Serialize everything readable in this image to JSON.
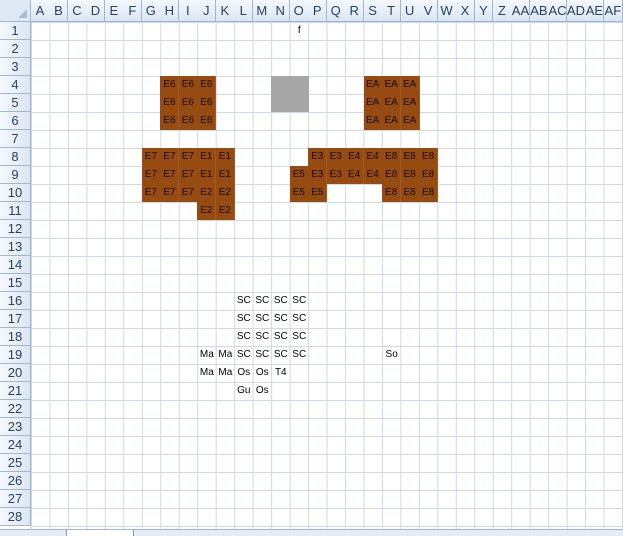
{
  "columns": [
    "A",
    "B",
    "C",
    "D",
    "E",
    "F",
    "G",
    "H",
    "I",
    "J",
    "K",
    "L",
    "M",
    "N",
    "O",
    "P",
    "Q",
    "R",
    "S",
    "T",
    "U",
    "V",
    "W",
    "X",
    "Y",
    "Z",
    "AA",
    "AB",
    "AC",
    "AD",
    "AE",
    "AF"
  ],
  "rows": [
    "1",
    "2",
    "3",
    "4",
    "5",
    "6",
    "7",
    "8",
    "9",
    "10",
    "11",
    "12",
    "13",
    "14",
    "15",
    "16",
    "17",
    "18",
    "19",
    "20",
    "21",
    "22",
    "23",
    "24",
    "25",
    "26",
    "27",
    "28"
  ],
  "colors": {
    "brown_fill": "#964b10",
    "gray_fill": "#a6a6a6",
    "grid_line": "#d0d7e5",
    "header_bg": "#dbe6f3"
  },
  "cells": [
    {
      "ref": "O1",
      "text": "f",
      "fill": ""
    },
    {
      "ref": "H4",
      "text": "E6",
      "fill": "brown"
    },
    {
      "ref": "I4",
      "text": "E6",
      "fill": "brown"
    },
    {
      "ref": "J4",
      "text": "E6",
      "fill": "brown"
    },
    {
      "ref": "N4",
      "text": "",
      "fill": "gray"
    },
    {
      "ref": "O4",
      "text": "",
      "fill": "gray"
    },
    {
      "ref": "N5",
      "text": "",
      "fill": "gray"
    },
    {
      "ref": "O5",
      "text": "",
      "fill": "gray"
    },
    {
      "ref": "S4",
      "text": "EA",
      "fill": "brown"
    },
    {
      "ref": "T4",
      "text": "EA",
      "fill": "brown"
    },
    {
      "ref": "U4",
      "text": "EA",
      "fill": "brown"
    },
    {
      "ref": "H5",
      "text": "E6",
      "fill": "brown"
    },
    {
      "ref": "I5",
      "text": "E6",
      "fill": "brown"
    },
    {
      "ref": "J5",
      "text": "E6",
      "fill": "brown"
    },
    {
      "ref": "S5",
      "text": "EA",
      "fill": "brown"
    },
    {
      "ref": "T5",
      "text": "EA",
      "fill": "brown"
    },
    {
      "ref": "U5",
      "text": "EA",
      "fill": "brown"
    },
    {
      "ref": "H6",
      "text": "E6",
      "fill": "brown"
    },
    {
      "ref": "I6",
      "text": "E6",
      "fill": "brown"
    },
    {
      "ref": "J6",
      "text": "E6",
      "fill": "brown"
    },
    {
      "ref": "S6",
      "text": "EA",
      "fill": "brown"
    },
    {
      "ref": "T6",
      "text": "EA",
      "fill": "brown"
    },
    {
      "ref": "U6",
      "text": "EA",
      "fill": "brown"
    },
    {
      "ref": "G8",
      "text": "E7",
      "fill": "brown"
    },
    {
      "ref": "H8",
      "text": "E7",
      "fill": "brown"
    },
    {
      "ref": "I8",
      "text": "E7",
      "fill": "brown"
    },
    {
      "ref": "J8",
      "text": "E1",
      "fill": "brown"
    },
    {
      "ref": "K8",
      "text": "E1",
      "fill": "brown"
    },
    {
      "ref": "P8",
      "text": "E3",
      "fill": "brown"
    },
    {
      "ref": "Q8",
      "text": "E3",
      "fill": "brown"
    },
    {
      "ref": "R8",
      "text": "E4",
      "fill": "brown"
    },
    {
      "ref": "S8",
      "text": "E4",
      "fill": "brown"
    },
    {
      "ref": "T8",
      "text": "E8",
      "fill": "brown"
    },
    {
      "ref": "U8",
      "text": "E8",
      "fill": "brown"
    },
    {
      "ref": "V8",
      "text": "E8",
      "fill": "brown"
    },
    {
      "ref": "G9",
      "text": "E7",
      "fill": "brown"
    },
    {
      "ref": "H9",
      "text": "E7",
      "fill": "brown"
    },
    {
      "ref": "I9",
      "text": "E7",
      "fill": "brown"
    },
    {
      "ref": "J9",
      "text": "E1",
      "fill": "brown"
    },
    {
      "ref": "K9",
      "text": "E1",
      "fill": "brown"
    },
    {
      "ref": "O9",
      "text": "E5",
      "fill": "brown"
    },
    {
      "ref": "P9",
      "text": "E3",
      "fill": "brown"
    },
    {
      "ref": "Q9",
      "text": "E3",
      "fill": "brown"
    },
    {
      "ref": "R9",
      "text": "E4",
      "fill": "brown"
    },
    {
      "ref": "S9",
      "text": "E4",
      "fill": "brown"
    },
    {
      "ref": "T9",
      "text": "E8",
      "fill": "brown"
    },
    {
      "ref": "U9",
      "text": "E8",
      "fill": "brown"
    },
    {
      "ref": "V9",
      "text": "E8",
      "fill": "brown"
    },
    {
      "ref": "G10",
      "text": "E7",
      "fill": "brown"
    },
    {
      "ref": "H10",
      "text": "E7",
      "fill": "brown"
    },
    {
      "ref": "I10",
      "text": "E7",
      "fill": "brown"
    },
    {
      "ref": "J10",
      "text": "E2",
      "fill": "brown"
    },
    {
      "ref": "K10",
      "text": "E2",
      "fill": "brown"
    },
    {
      "ref": "O10",
      "text": "E5",
      "fill": "brown"
    },
    {
      "ref": "P10",
      "text": "E5",
      "fill": "brown"
    },
    {
      "ref": "T10",
      "text": "E8",
      "fill": "brown"
    },
    {
      "ref": "U10",
      "text": "E8",
      "fill": "brown"
    },
    {
      "ref": "V10",
      "text": "E8",
      "fill": "brown"
    },
    {
      "ref": "J11",
      "text": "E2",
      "fill": "brown"
    },
    {
      "ref": "K11",
      "text": "E2",
      "fill": "brown"
    },
    {
      "ref": "L16",
      "text": "SC",
      "fill": ""
    },
    {
      "ref": "M16",
      "text": "SC",
      "fill": ""
    },
    {
      "ref": "N16",
      "text": "SC",
      "fill": ""
    },
    {
      "ref": "O16",
      "text": "SC",
      "fill": ""
    },
    {
      "ref": "L17",
      "text": "SC",
      "fill": ""
    },
    {
      "ref": "M17",
      "text": "SC",
      "fill": ""
    },
    {
      "ref": "N17",
      "text": "SC",
      "fill": ""
    },
    {
      "ref": "O17",
      "text": "SC",
      "fill": ""
    },
    {
      "ref": "L18",
      "text": "SC",
      "fill": ""
    },
    {
      "ref": "M18",
      "text": "SC",
      "fill": ""
    },
    {
      "ref": "N18",
      "text": "SC",
      "fill": ""
    },
    {
      "ref": "O18",
      "text": "SC",
      "fill": ""
    },
    {
      "ref": "J19",
      "text": "Ma",
      "fill": ""
    },
    {
      "ref": "K19",
      "text": "Ma",
      "fill": ""
    },
    {
      "ref": "L19",
      "text": "SC",
      "fill": ""
    },
    {
      "ref": "M19",
      "text": "SC",
      "fill": ""
    },
    {
      "ref": "N19",
      "text": "SC",
      "fill": ""
    },
    {
      "ref": "O19",
      "text": "SC",
      "fill": ""
    },
    {
      "ref": "T19",
      "text": "So",
      "fill": ""
    },
    {
      "ref": "J20",
      "text": "Ma",
      "fill": ""
    },
    {
      "ref": "K20",
      "text": "Ma",
      "fill": ""
    },
    {
      "ref": "L20",
      "text": "Os",
      "fill": ""
    },
    {
      "ref": "M20",
      "text": "Os",
      "fill": ""
    },
    {
      "ref": "N20",
      "text": "T4",
      "fill": ""
    },
    {
      "ref": "L21",
      "text": "Gu",
      "fill": ""
    },
    {
      "ref": "M21",
      "text": "Os",
      "fill": ""
    }
  ]
}
